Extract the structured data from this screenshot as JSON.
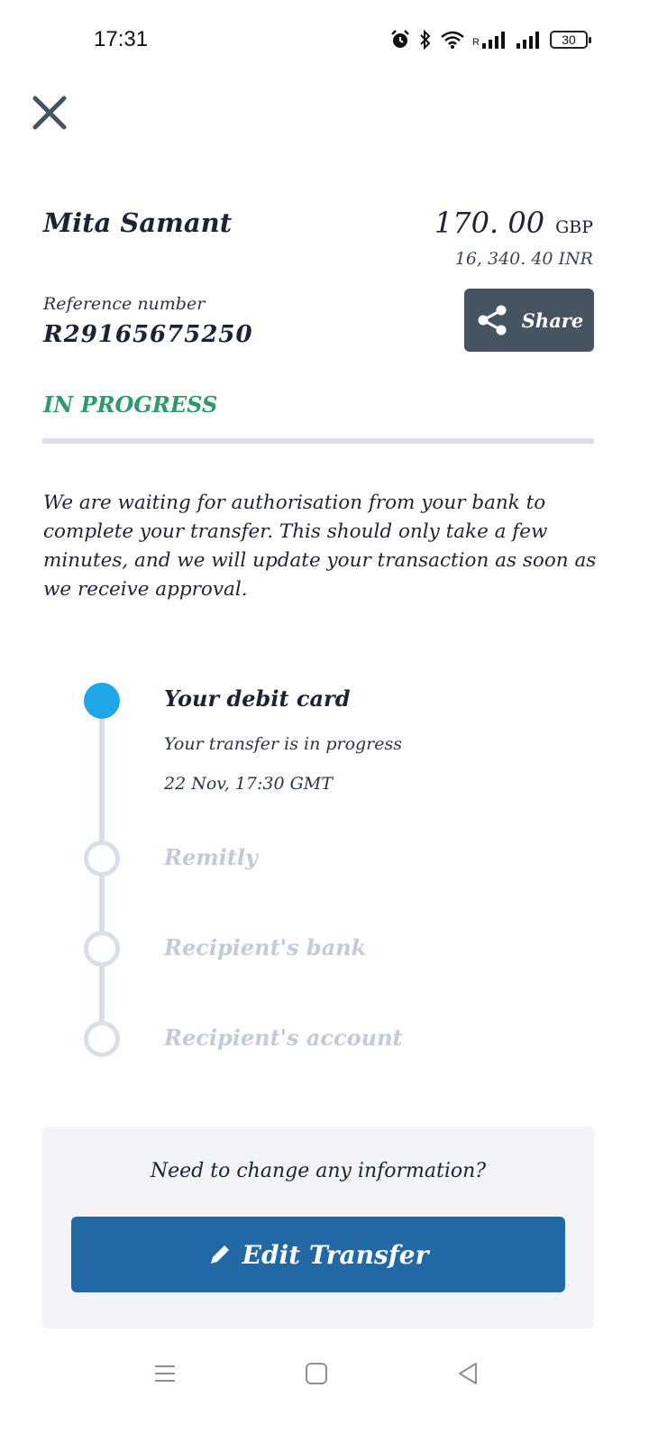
{
  "status_bar": {
    "time": "17:31",
    "battery": "30",
    "roaming_label": "R"
  },
  "transfer": {
    "recipient_name": "Mita Samant",
    "amount": "170. 00",
    "currency": "GBP",
    "converted_amount": "16, 340. 40 INR",
    "reference_label": "Reference number",
    "reference_number": "R29165675250",
    "share_label": "Share",
    "status": "IN PROGRESS",
    "message": "We are waiting for authorisation from your bank to complete your transfer. This should only take a few minutes, and we will update your transaction as soon as we receive approval."
  },
  "timeline": {
    "steps": [
      {
        "title": "Your debit card",
        "subtitle": "Your transfer is in progress",
        "time": "22 Nov, 17:30 GMT",
        "state": "active"
      },
      {
        "title": "Remitly",
        "state": "pending"
      },
      {
        "title": "Recipient's bank",
        "state": "pending"
      },
      {
        "title": "Recipient's account",
        "state": "pending"
      }
    ]
  },
  "help": {
    "question": "Need to change any information?",
    "edit_label": "Edit Transfer"
  },
  "colors": {
    "status_green": "#2e9a6a",
    "active_dot": "#1ea6e6",
    "primary_button": "#2268a4",
    "share_button": "#465461"
  },
  "icons": [
    "alarm-icon",
    "bluetooth-icon",
    "wifi-icon",
    "signal-icon",
    "battery-icon",
    "close-icon",
    "share-icon",
    "pencil-icon",
    "menu-icon",
    "home-icon",
    "back-icon"
  ]
}
